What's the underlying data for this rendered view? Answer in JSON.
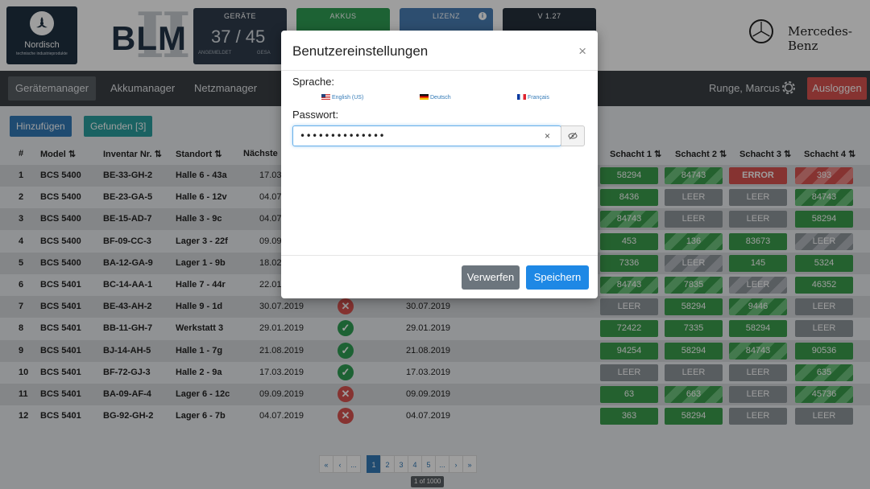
{
  "header": {
    "logo_name": "Nordisch",
    "logo_subtitle": "technische industrieprodukte",
    "blm_text": "BLM",
    "blm_roman": "II",
    "tiles": {
      "geraete_label": "GERÄTE",
      "geraete_value": "37 / 45",
      "geraete_sub_left": "ANGEMELDET",
      "geraete_sub_right": "GESA",
      "akkus_label": "AKKUS",
      "lizenz_label": "LIZENZ",
      "version_label": "V 1.27"
    },
    "brand": "Mercedes-Benz"
  },
  "nav": {
    "items": [
      "Gerätemanager",
      "Akkumanager",
      "Netzmanager"
    ],
    "active": "Gerätemanager",
    "user": "Runge, Marcus",
    "logout": "Ausloggen"
  },
  "toolbar": {
    "add": "Hinzufügen",
    "found": "Gefunden [3]"
  },
  "table": {
    "headers": {
      "id": "#",
      "model": "Model ⇅",
      "inventory": "Inventar Nr. ⇅",
      "location": "Standort ⇅",
      "next": "Nächste",
      "slot1": "Schacht 1 ⇅",
      "slot2": "Schacht 2 ⇅",
      "slot3": "Schacht 3 ⇅",
      "slot4": "Schacht 4 ⇅"
    },
    "rows": [
      {
        "id": "1",
        "model": "BCS 5400",
        "inv": "BE-33-GH-2",
        "loc": "Halle 6 - 43a",
        "date": "17.03",
        "status": "",
        "date2": "",
        "slots": [
          [
            "58294",
            "green"
          ],
          [
            "84743",
            "green-str"
          ],
          [
            "ERROR",
            "red"
          ],
          [
            "393",
            "red-str"
          ]
        ]
      },
      {
        "id": "2",
        "model": "BCS 5400",
        "inv": "BE-23-GA-5",
        "loc": "Halle 6 - 12v",
        "date": "04.07",
        "status": "",
        "date2": "",
        "slots": [
          [
            "8436",
            "green"
          ],
          [
            "LEER",
            "gray"
          ],
          [
            "LEER",
            "gray"
          ],
          [
            "84743",
            "green-str"
          ]
        ]
      },
      {
        "id": "3",
        "model": "BCS 5400",
        "inv": "BE-15-AD-7",
        "loc": "Halle 3 - 9c",
        "date": "04.07",
        "status": "",
        "date2": "",
        "slots": [
          [
            "84743",
            "green-str"
          ],
          [
            "LEER",
            "gray"
          ],
          [
            "LEER",
            "gray"
          ],
          [
            "58294",
            "green"
          ]
        ]
      },
      {
        "id": "4",
        "model": "BCS 5400",
        "inv": "BF-09-CC-3",
        "loc": "Lager 3 - 22f",
        "date": "09.09",
        "status": "",
        "date2": "",
        "slots": [
          [
            "453",
            "green"
          ],
          [
            "136",
            "green-str"
          ],
          [
            "83673",
            "green"
          ],
          [
            "LEER",
            "gray-str"
          ]
        ]
      },
      {
        "id": "5",
        "model": "BCS 5400",
        "inv": "BA-12-GA-9",
        "loc": "Lager 1 - 9b",
        "date": "18.02",
        "status": "",
        "date2": "",
        "slots": [
          [
            "7336",
            "green"
          ],
          [
            "LEER",
            "gray-str"
          ],
          [
            "145",
            "green"
          ],
          [
            "5324",
            "green"
          ]
        ]
      },
      {
        "id": "6",
        "model": "BCS 5401",
        "inv": "BC-14-AA-1",
        "loc": "Halle 7 - 44r",
        "date": "22.01",
        "status": "",
        "date2": "",
        "slots": [
          [
            "84743",
            "green-str"
          ],
          [
            "7835",
            "green-str"
          ],
          [
            "LEER",
            "gray-str"
          ],
          [
            "46352",
            "green"
          ]
        ]
      },
      {
        "id": "7",
        "model": "BCS 5401",
        "inv": "BE-43-AH-2",
        "loc": "Halle 9 - 1d",
        "date": "30.07.2019",
        "status": "err",
        "date2": "30.07.2019",
        "slots": [
          [
            "LEER",
            "gray"
          ],
          [
            "58294",
            "green"
          ],
          [
            "9446",
            "green-str"
          ],
          [
            "LEER",
            "gray"
          ]
        ]
      },
      {
        "id": "8",
        "model": "BCS 5401",
        "inv": "BB-11-GH-7",
        "loc": "Werkstatt 3",
        "date": "29.01.2019",
        "status": "ok",
        "date2": "29.01.2019",
        "slots": [
          [
            "72422",
            "green"
          ],
          [
            "7335",
            "green"
          ],
          [
            "58294",
            "green"
          ],
          [
            "LEER",
            "gray"
          ]
        ]
      },
      {
        "id": "9",
        "model": "BCS 5401",
        "inv": "BJ-14-AH-5",
        "loc": "Halle 1 - 7g",
        "date": "21.08.2019",
        "status": "ok",
        "date2": "21.08.2019",
        "slots": [
          [
            "94254",
            "green"
          ],
          [
            "58294",
            "green"
          ],
          [
            "84743",
            "green-str"
          ],
          [
            "90536",
            "green"
          ]
        ]
      },
      {
        "id": "10",
        "model": "BCS 5401",
        "inv": "BF-72-GJ-3",
        "loc": "Halle 2 - 9a",
        "date": "17.03.2019",
        "status": "ok",
        "date2": "17.03.2019",
        "slots": [
          [
            "LEER",
            "gray"
          ],
          [
            "LEER",
            "gray"
          ],
          [
            "LEER",
            "gray"
          ],
          [
            "635",
            "green-str"
          ]
        ]
      },
      {
        "id": "11",
        "model": "BCS 5401",
        "inv": "BA-09-AF-4",
        "loc": "Lager 6 - 12c",
        "date": "09.09.2019",
        "status": "err",
        "date2": "09.09.2019",
        "slots": [
          [
            "63",
            "green"
          ],
          [
            "663",
            "green-str"
          ],
          [
            "LEER",
            "gray"
          ],
          [
            "45736",
            "green-str"
          ]
        ]
      },
      {
        "id": "12",
        "model": "BCS 5401",
        "inv": "BG-92-GH-2",
        "loc": "Lager 6 - 7b",
        "date": "04.07.2019",
        "status": "err",
        "date2": "04.07.2019",
        "slots": [
          [
            "363",
            "green"
          ],
          [
            "58294",
            "green"
          ],
          [
            "LEER",
            "gray"
          ],
          [
            "LEER",
            "gray"
          ]
        ]
      }
    ]
  },
  "pagination": {
    "items": [
      "«",
      "‹",
      "...",
      "1",
      "2",
      "3",
      "4",
      "5",
      "...",
      "›",
      "»"
    ],
    "active": "1",
    "info": "1 of 1000"
  },
  "modal": {
    "title": "Benutzereinstellungen",
    "close": "×",
    "language_label": "Sprache:",
    "languages": [
      "English (US)",
      "Deutsch",
      "Français"
    ],
    "password_label": "Passwort:",
    "password_value": "••••••••••••••",
    "clear": "×",
    "discard": "Verwerfen",
    "save": "Speichern"
  },
  "colors": {
    "accent": "#337ab7",
    "success": "#3a9d4c",
    "danger": "#d9534f",
    "navbar": "#3b3f44"
  },
  "icons": {
    "logo": "propeller-icon",
    "brand": "mercedes-star-icon",
    "settings": "gear-icon",
    "info": "info-icon",
    "status_ok": "check-circle-icon",
    "status_err": "x-circle-icon",
    "toggle_visibility": "eye-slash-icon"
  }
}
